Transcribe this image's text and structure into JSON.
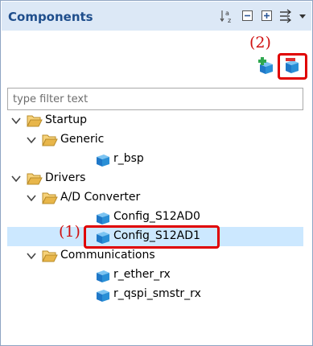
{
  "panel": {
    "title": "Components",
    "toolbar": [
      {
        "name": "sort-alphabetically-icon"
      },
      {
        "name": "collapse-all-icon"
      },
      {
        "name": "expand-all-icon"
      },
      {
        "name": "filter-view-icon"
      },
      {
        "name": "view-menu-chevron-icon"
      }
    ]
  },
  "annotations": {
    "step1": "(1)",
    "step2": "(2)"
  },
  "actions": {
    "add_component_icon": "add-component-icon",
    "remove_component_icon": "remove-component-icon"
  },
  "filter": {
    "placeholder": "type filter text",
    "value": ""
  },
  "tree": [
    {
      "label": "Startup",
      "type": "folder",
      "level": 0,
      "expanded": true
    },
    {
      "label": "Generic",
      "type": "folder",
      "level": 1,
      "expanded": true
    },
    {
      "label": "r_bsp",
      "type": "component",
      "level": 2
    },
    {
      "label": "Drivers",
      "type": "folder",
      "level": 0,
      "expanded": true
    },
    {
      "label": "A/D Converter",
      "type": "folder",
      "level": 1,
      "expanded": true
    },
    {
      "label": "Config_S12AD0",
      "type": "component",
      "level": 2
    },
    {
      "label": "Config_S12AD1",
      "type": "component",
      "level": 2,
      "selected": true
    },
    {
      "label": "Communications",
      "type": "folder",
      "level": 1,
      "expanded": true
    },
    {
      "label": "r_ether_rx",
      "type": "component",
      "level": 2
    },
    {
      "label": "r_qspi_smstr_rx",
      "type": "component",
      "level": 2
    }
  ],
  "colors": {
    "title": "#1f4e8c",
    "titlebar_bg": "#dce8f6",
    "selection": "#cce8ff",
    "highlight": "#e00000",
    "folder": "#e8b64a",
    "component": "#2a8fd6"
  }
}
